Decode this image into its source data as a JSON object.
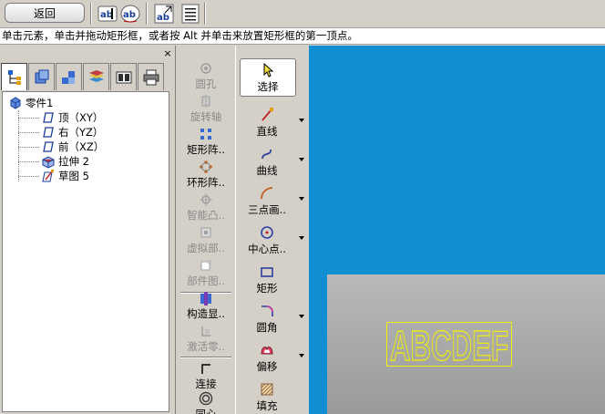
{
  "toolbar": {
    "back_label": "返回",
    "icons": [
      "text-edit-icon",
      "text-style-icon",
      "text-align-icon",
      "list-icon"
    ]
  },
  "prompt": {
    "text": "单击元素，单击并拖动矩形框，或者按 Alt 并单击来放置矩形框的第一顶点。"
  },
  "tree_panel": {
    "close": "×",
    "tabs": [
      "model-tree-icon",
      "part-icon",
      "assembly-icon",
      "layers-icon",
      "views-icon",
      "printer-icon"
    ],
    "nodes": [
      {
        "label": "零件1",
        "icon": "part-icon"
      },
      {
        "label": "顶（XY）",
        "icon": "plane-icon"
      },
      {
        "label": "右（YZ）",
        "icon": "plane-icon"
      },
      {
        "label": "前（XZ）",
        "icon": "plane-icon"
      },
      {
        "label": "拉伸 2",
        "icon": "extrude-icon"
      },
      {
        "label": "草图 5",
        "icon": "sketch-icon"
      }
    ]
  },
  "feature_tools": [
    {
      "label": "圆孔",
      "enabled": false
    },
    {
      "label": "旋转轴",
      "enabled": false
    },
    {
      "label": "矩形阵..",
      "enabled": true
    },
    {
      "label": "环形阵..",
      "enabled": true
    },
    {
      "label": "智能凸..",
      "enabled": false
    },
    {
      "label": "虚拟部..",
      "enabled": false
    },
    {
      "label": "部件图..",
      "enabled": false
    },
    {
      "label": "构造显..",
      "enabled": true
    },
    {
      "label": "激活零..",
      "enabled": false
    },
    {
      "label": "连接",
      "enabled": true
    },
    {
      "label": "同心",
      "enabled": true
    }
  ],
  "sketch_tools": [
    {
      "label": "选择",
      "dropdown": false
    },
    {
      "label": "直线",
      "dropdown": true
    },
    {
      "label": "曲线",
      "dropdown": true
    },
    {
      "label": "三点画..",
      "dropdown": true
    },
    {
      "label": "中心点..",
      "dropdown": true
    },
    {
      "label": "矩形",
      "dropdown": false
    },
    {
      "label": "圆角",
      "dropdown": true
    },
    {
      "label": "偏移",
      "dropdown": true
    },
    {
      "label": "填充",
      "dropdown": false
    }
  ],
  "viewport": {
    "sketch_text": "ABCDEF",
    "background_color": "#0f8ed4",
    "sketch_color": "#f2f200"
  }
}
